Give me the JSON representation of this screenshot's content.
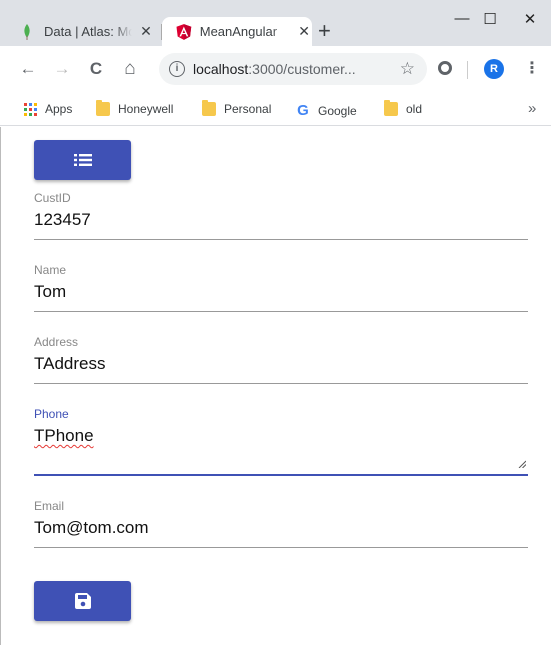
{
  "browser": {
    "tabs": [
      {
        "label": "Data | Atlas: MongoDB",
        "close": "✕"
      },
      {
        "label": "MeanAngular",
        "close": "✕"
      }
    ],
    "new_tab": "+",
    "window_controls": {
      "minimize": "—",
      "maximize": "☐",
      "close": "✕"
    },
    "nav": {
      "back": "←",
      "forward": "→",
      "reload": "C",
      "home": "⌂"
    },
    "url_host": "localhost",
    "url_rest": ":3000/customer...",
    "star": "☆",
    "avatar_letter": "R",
    "menu": "⋮",
    "bookmarks": [
      {
        "label": "Apps",
        "icon": "apps-icon"
      },
      {
        "label": "Honeywell",
        "icon": "folder-icon"
      },
      {
        "label": "Personal",
        "icon": "folder-icon"
      },
      {
        "label": "Google",
        "icon": "google-icon"
      },
      {
        "label": "old",
        "icon": "folder-icon"
      }
    ],
    "bookmarks_more": "»",
    "accent_color": "#3f51b5"
  },
  "form": {
    "fields": [
      {
        "label": "CustID",
        "value": "123457"
      },
      {
        "label": "Name",
        "value": "Tom"
      },
      {
        "label": "Address",
        "value": "TAddress"
      },
      {
        "label": "Phone",
        "value": "TPhone",
        "focused": true
      },
      {
        "label": "Email",
        "value": "Tom@tom.com"
      }
    ],
    "list_button_icon": "list-icon",
    "save_button_icon": "save-icon"
  }
}
